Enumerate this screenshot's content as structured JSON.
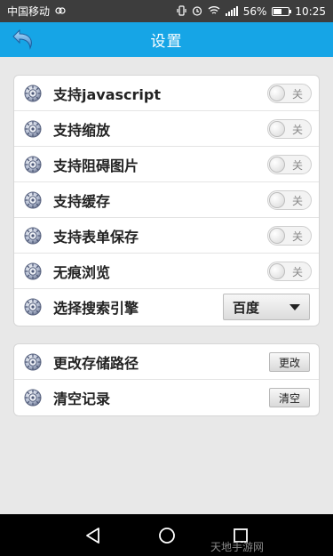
{
  "status_bar": {
    "carrier": "中国移动",
    "battery_text": "56%",
    "battery_level": 0.56,
    "time": "10:25",
    "icons": [
      "link-icon",
      "vibrate-icon",
      "alarm-icon",
      "wifi-icon",
      "signal-icon",
      "battery-icon"
    ]
  },
  "title_bar": {
    "title": "设置",
    "back_icon": "back-arrow-icon",
    "color": "#16a5e6"
  },
  "settings": {
    "items": [
      {
        "label": "支持javascript",
        "toggle_text": "关",
        "on": false
      },
      {
        "label": "支持缩放",
        "toggle_text": "关",
        "on": false
      },
      {
        "label": "支持阻碍图片",
        "toggle_text": "关",
        "on": false
      },
      {
        "label": "支持缓存",
        "toggle_text": "关",
        "on": false
      },
      {
        "label": "支持表单保存",
        "toggle_text": "关",
        "on": false
      },
      {
        "label": "无痕浏览",
        "toggle_text": "关",
        "on": false
      }
    ],
    "search_engine": {
      "label": "选择搜索引擎",
      "selected": "百度"
    }
  },
  "storage": {
    "path_label": "更改存储路径",
    "path_button": "更改",
    "clear_label": "清空记录",
    "clear_button": "清空"
  },
  "nav_bar": {
    "icons": [
      "nav-back-icon",
      "nav-home-icon",
      "nav-recents-icon"
    ]
  },
  "watermark": "天地手游网"
}
